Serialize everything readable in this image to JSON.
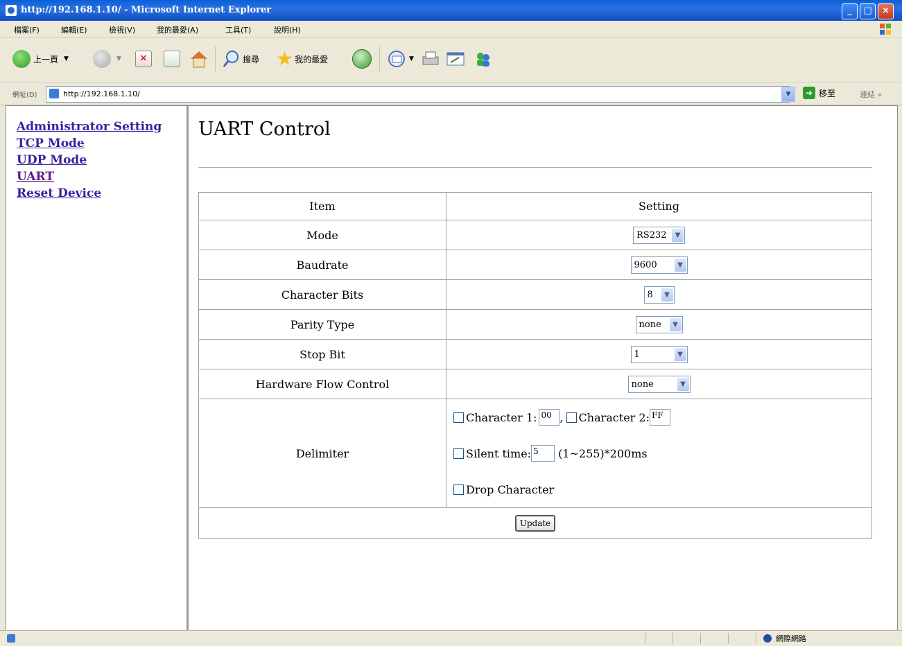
{
  "window": {
    "title": "http://192.168.1.10/ - Microsoft Internet Explorer",
    "min_label": "_",
    "max_label": "□",
    "close_label": "×"
  },
  "menu": [
    "檔案(F)",
    "編輯(E)",
    "檢視(V)",
    "我的最愛(A)",
    "工具(T)",
    "說明(H)"
  ],
  "toolbar": {
    "back_label": "上一頁",
    "search_label": "搜尋",
    "favorites_label": "我的最愛"
  },
  "address": {
    "label": "網址(D)",
    "url": "http://192.168.1.10/",
    "go_label": "移至",
    "links_label": "連結 »"
  },
  "nav": {
    "items": [
      "Administrator Setting",
      "TCP Mode",
      "UDP Mode",
      "UART",
      "Reset Device"
    ]
  },
  "page": {
    "title": "UART Control",
    "header_item": "Item",
    "header_setting": "Setting",
    "rows": [
      {
        "label": "Mode",
        "value": "RS232"
      },
      {
        "label": "Baudrate",
        "value": "9600"
      },
      {
        "label": "Character Bits",
        "value": "8"
      },
      {
        "label": "Parity Type",
        "value": "none"
      },
      {
        "label": "Stop Bit",
        "value": "1"
      },
      {
        "label": "Hardware Flow Control",
        "value": "none"
      }
    ],
    "delimiter": {
      "label": "Delimiter",
      "char1_label": "Character 1:",
      "char1_value": "00",
      "comma": ",",
      "char2_label": "Character 2:",
      "char2_value": "FF",
      "silent_label": "Silent time:",
      "silent_value": "5",
      "silent_unit": "(1~255)*200ms",
      "drop_label": "Drop Character"
    },
    "update_label": "Update"
  },
  "status": {
    "zone": "網際網路"
  }
}
